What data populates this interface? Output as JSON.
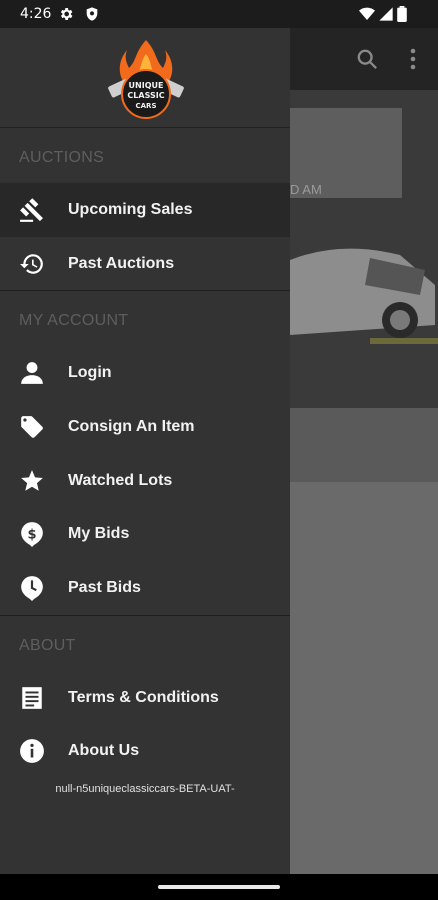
{
  "status_bar": {
    "time": "4:26"
  },
  "drawer": {
    "sections": [
      {
        "title": "AUCTIONS",
        "items": [
          {
            "label": "Upcoming Sales",
            "icon": "gavel-icon",
            "active": true
          },
          {
            "label": "Past Auctions",
            "icon": "history-icon",
            "active": false
          }
        ]
      },
      {
        "title": "MY ACCOUNT",
        "items": [
          {
            "label": "Login",
            "icon": "person-icon"
          },
          {
            "label": "Consign An Item",
            "icon": "tag-icon"
          },
          {
            "label": "Watched Lots",
            "icon": "star-icon"
          },
          {
            "label": "My Bids",
            "icon": "dollar-pin-icon"
          },
          {
            "label": "Past Bids",
            "icon": "clock-pin-icon"
          }
        ]
      },
      {
        "title": "ABOUT",
        "items": [
          {
            "label": "Terms & Conditions",
            "icon": "document-icon"
          },
          {
            "label": "About Us",
            "icon": "info-icon"
          }
        ]
      }
    ],
    "build_text": "null-n5uniqueclassiccars-BETA-UAT-"
  },
  "background": {
    "hero_text": "D AM"
  },
  "colors": {
    "drawer_bg": "#333333",
    "active_bg": "#282828",
    "section_title": "#5e5e5e",
    "scrim": "#6a6a6a",
    "toolbar": "#242424",
    "logo_flame": "#f26a1b"
  }
}
